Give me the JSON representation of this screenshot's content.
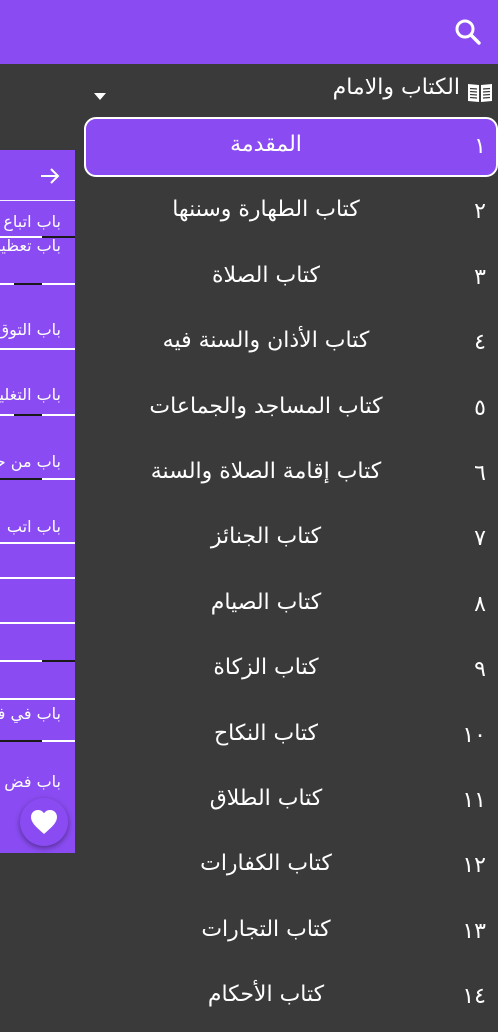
{
  "header": {
    "title": "الكتاب والامام"
  },
  "chapters": [
    {
      "num": "١",
      "title": "المقدمة",
      "active": true
    },
    {
      "num": "٢",
      "title": "كتاب الطهارة وسننها"
    },
    {
      "num": "٣",
      "title": "كتاب الصلاة"
    },
    {
      "num": "٤",
      "title": "كتاب الأذان والسنة فيه"
    },
    {
      "num": "٥",
      "title": "كتاب المساجد والجماعات"
    },
    {
      "num": "٦",
      "title": "كتاب إقامة الصلاة والسنة"
    },
    {
      "num": "٧",
      "title": "كتاب الجنائز"
    },
    {
      "num": "٨",
      "title": "كتاب الصيام"
    },
    {
      "num": "٩",
      "title": "كتاب الزكاة"
    },
    {
      "num": "١٠",
      "title": "كتاب النكاح"
    },
    {
      "num": "١١",
      "title": "كتاب الطلاق"
    },
    {
      "num": "١٢",
      "title": "كتاب الكفارات"
    },
    {
      "num": "١٣",
      "title": "كتاب التجارات"
    },
    {
      "num": "١٤",
      "title": "كتاب الأحكام"
    }
  ],
  "side_panel": {
    "items": [
      {
        "line1": "باب اتباع",
        "line2": "باب تعظيم"
      },
      {
        "line1": "باب التوق",
        "line2": ""
      },
      {
        "line1": "باب التغليظ",
        "line2": ""
      },
      {
        "line1": "باب من حد",
        "line2": ""
      },
      {
        "line1": "باب اتب",
        "line2": ""
      },
      {
        "line1": "",
        "line2": ""
      },
      {
        "line1": "",
        "line2": ""
      },
      {
        "line1": "باب في فض",
        "line2": ""
      },
      {
        "line1": "باب فض",
        "line2": ""
      }
    ]
  },
  "colors": {
    "accent": "#8a4cf2",
    "background": "#3a3a3a",
    "text": "#ffffff"
  }
}
